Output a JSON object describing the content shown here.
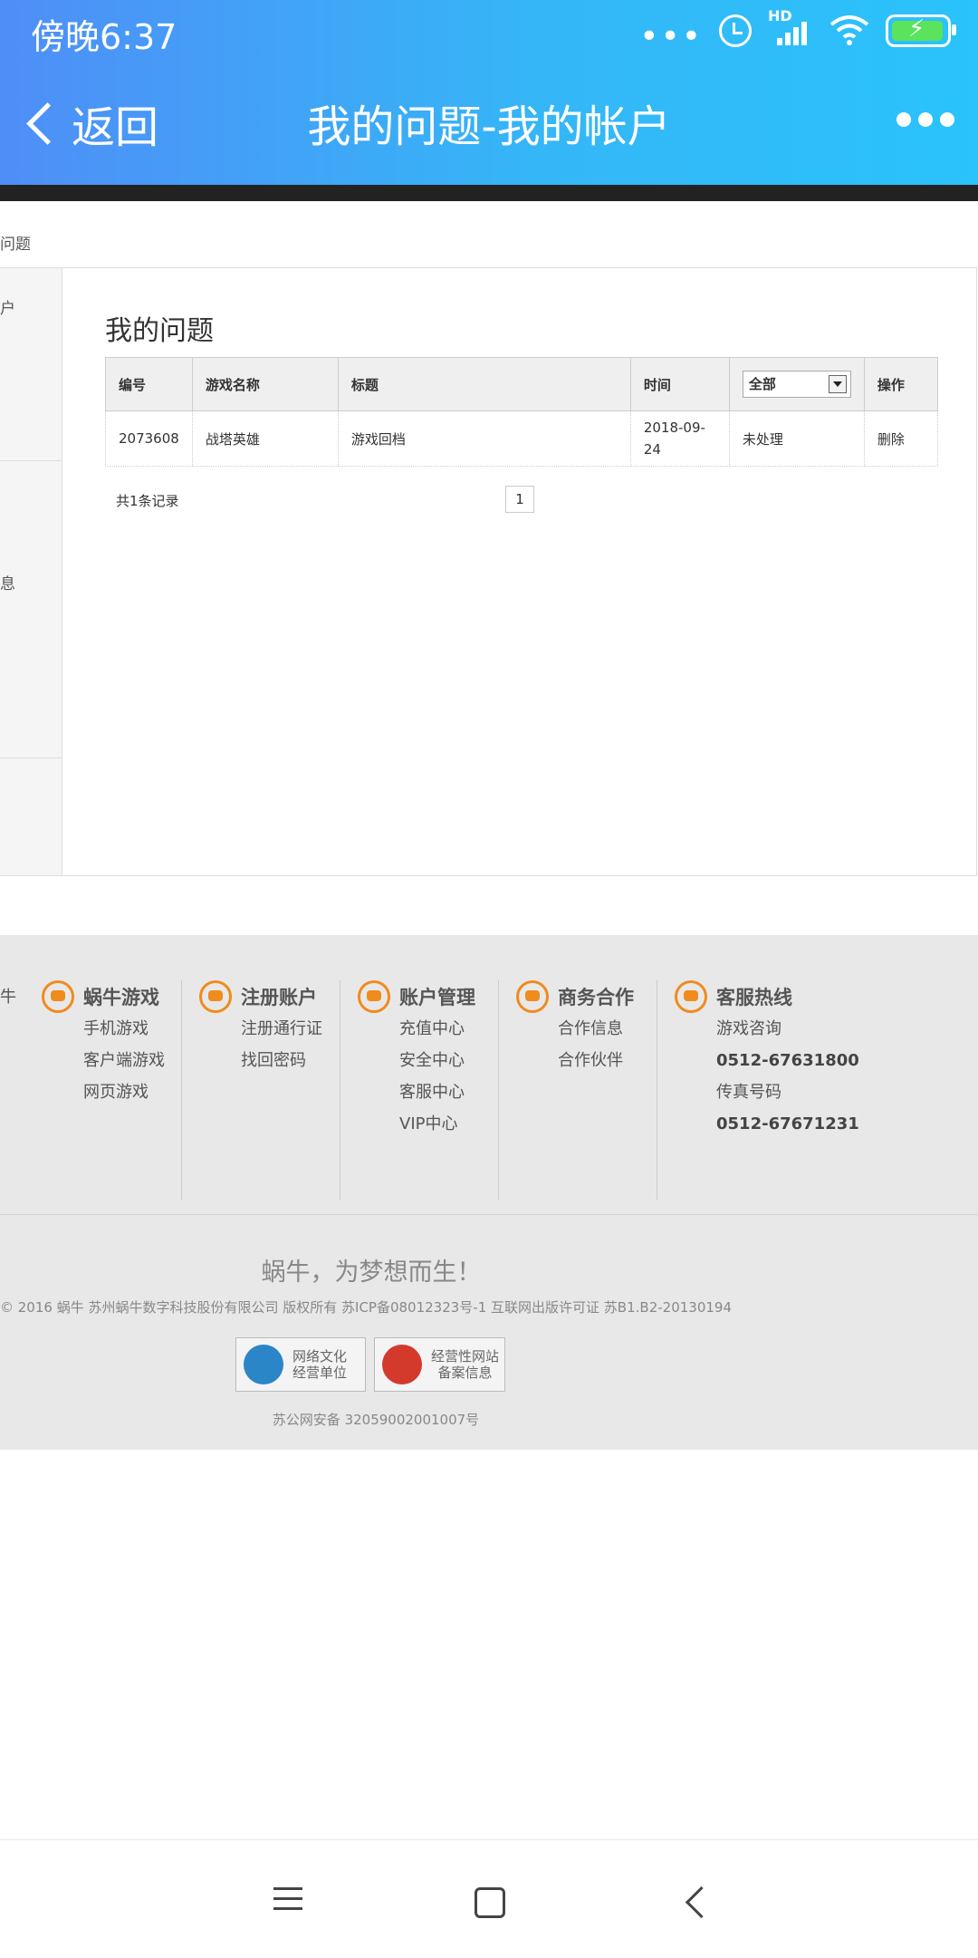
{
  "status_bar": {
    "time": "傍晚6:37",
    "network_tag": "HD"
  },
  "header": {
    "back_label": "返回",
    "title": "我的问题-我的帐户"
  },
  "breadcrumb_fragment": "问题",
  "sidebar_fragments": [
    "户",
    "息"
  ],
  "content": {
    "section_title": "我的问题",
    "table": {
      "columns": [
        "编号",
        "游戏名称",
        "标题",
        "时间",
        "全部",
        "操作"
      ],
      "status_filter": "全部",
      "rows": [
        {
          "id": "2073608",
          "game": "战塔英雄",
          "title": "游戏回档",
          "time": "2018-09-24",
          "status": "未处理",
          "action": "删除"
        }
      ]
    },
    "record_count": "共1条记录",
    "page": "1"
  },
  "footer": {
    "left_fragment": "牛",
    "columns": [
      {
        "icon": "gamepad-icon",
        "title": "蜗牛游戏",
        "items": [
          "手机游戏",
          "客户端游戏",
          "网页游戏"
        ]
      },
      {
        "icon": "user-add-icon",
        "title": "注册账户",
        "items": [
          "注册通行证",
          "找回密码"
        ]
      },
      {
        "icon": "user-icon",
        "title": "账户管理",
        "items": [
          "充值中心",
          "安全中心",
          "客服中心",
          "VIP中心"
        ]
      },
      {
        "icon": "handshake-icon",
        "title": "商务合作",
        "items": [
          "合作信息",
          "合作伙伴"
        ]
      },
      {
        "icon": "phone-icon",
        "title": "客服热线",
        "items": [
          "游戏咨询",
          "0512-67631800",
          "传真号码",
          "0512-67671231"
        ]
      }
    ],
    "slogan": "蜗牛，为梦想而生！",
    "copyright": "© 2016 蜗牛 苏州蜗牛数字科技股份有限公司 版权所有 苏ICP备08012323号-1 互联网出版许可证   苏B1.B2-20130194",
    "badges": [
      {
        "line1": "网络文化",
        "line2": "经营单位",
        "icon": "culture-badge-icon",
        "color": "#2b86c7"
      },
      {
        "line1": "经营性网站",
        "line2": "备案信息",
        "icon": "police-badge-icon",
        "color": "#d33a2c"
      }
    ],
    "beian": "苏公网安备 32059002001007号"
  },
  "colors": {
    "header_start": "#4f8ef7",
    "header_end": "#2ac3fb",
    "link": "#4a90d9",
    "footer_icon": "#f08b1e"
  }
}
